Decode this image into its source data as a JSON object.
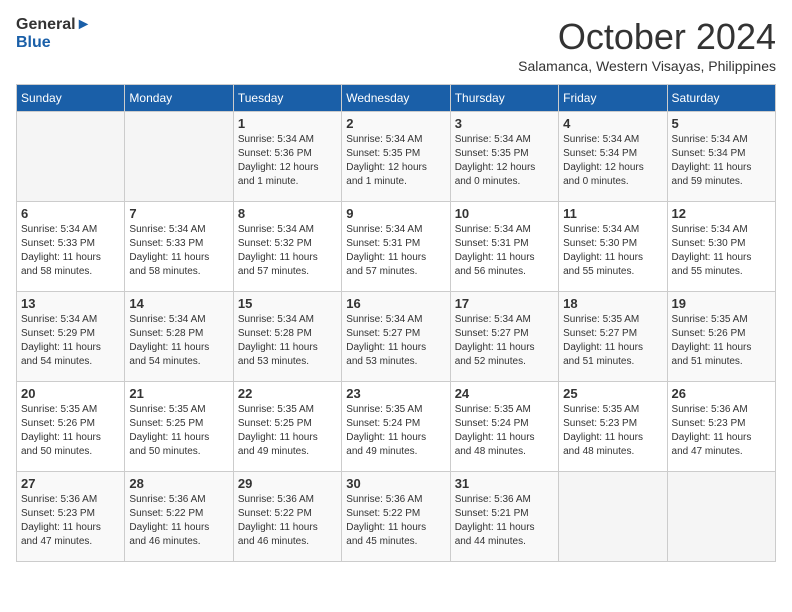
{
  "logo": {
    "line1": "General",
    "line2": "Blue"
  },
  "title": "October 2024",
  "location": "Salamanca, Western Visayas, Philippines",
  "weekdays": [
    "Sunday",
    "Monday",
    "Tuesday",
    "Wednesday",
    "Thursday",
    "Friday",
    "Saturday"
  ],
  "weeks": [
    [
      {
        "day": "",
        "info": ""
      },
      {
        "day": "",
        "info": ""
      },
      {
        "day": "1",
        "info": "Sunrise: 5:34 AM\nSunset: 5:36 PM\nDaylight: 12 hours\nand 1 minute."
      },
      {
        "day": "2",
        "info": "Sunrise: 5:34 AM\nSunset: 5:35 PM\nDaylight: 12 hours\nand 1 minute."
      },
      {
        "day": "3",
        "info": "Sunrise: 5:34 AM\nSunset: 5:35 PM\nDaylight: 12 hours\nand 0 minutes."
      },
      {
        "day": "4",
        "info": "Sunrise: 5:34 AM\nSunset: 5:34 PM\nDaylight: 12 hours\nand 0 minutes."
      },
      {
        "day": "5",
        "info": "Sunrise: 5:34 AM\nSunset: 5:34 PM\nDaylight: 11 hours\nand 59 minutes."
      }
    ],
    [
      {
        "day": "6",
        "info": "Sunrise: 5:34 AM\nSunset: 5:33 PM\nDaylight: 11 hours\nand 58 minutes."
      },
      {
        "day": "7",
        "info": "Sunrise: 5:34 AM\nSunset: 5:33 PM\nDaylight: 11 hours\nand 58 minutes."
      },
      {
        "day": "8",
        "info": "Sunrise: 5:34 AM\nSunset: 5:32 PM\nDaylight: 11 hours\nand 57 minutes."
      },
      {
        "day": "9",
        "info": "Sunrise: 5:34 AM\nSunset: 5:31 PM\nDaylight: 11 hours\nand 57 minutes."
      },
      {
        "day": "10",
        "info": "Sunrise: 5:34 AM\nSunset: 5:31 PM\nDaylight: 11 hours\nand 56 minutes."
      },
      {
        "day": "11",
        "info": "Sunrise: 5:34 AM\nSunset: 5:30 PM\nDaylight: 11 hours\nand 55 minutes."
      },
      {
        "day": "12",
        "info": "Sunrise: 5:34 AM\nSunset: 5:30 PM\nDaylight: 11 hours\nand 55 minutes."
      }
    ],
    [
      {
        "day": "13",
        "info": "Sunrise: 5:34 AM\nSunset: 5:29 PM\nDaylight: 11 hours\nand 54 minutes."
      },
      {
        "day": "14",
        "info": "Sunrise: 5:34 AM\nSunset: 5:28 PM\nDaylight: 11 hours\nand 54 minutes."
      },
      {
        "day": "15",
        "info": "Sunrise: 5:34 AM\nSunset: 5:28 PM\nDaylight: 11 hours\nand 53 minutes."
      },
      {
        "day": "16",
        "info": "Sunrise: 5:34 AM\nSunset: 5:27 PM\nDaylight: 11 hours\nand 53 minutes."
      },
      {
        "day": "17",
        "info": "Sunrise: 5:34 AM\nSunset: 5:27 PM\nDaylight: 11 hours\nand 52 minutes."
      },
      {
        "day": "18",
        "info": "Sunrise: 5:35 AM\nSunset: 5:27 PM\nDaylight: 11 hours\nand 51 minutes."
      },
      {
        "day": "19",
        "info": "Sunrise: 5:35 AM\nSunset: 5:26 PM\nDaylight: 11 hours\nand 51 minutes."
      }
    ],
    [
      {
        "day": "20",
        "info": "Sunrise: 5:35 AM\nSunset: 5:26 PM\nDaylight: 11 hours\nand 50 minutes."
      },
      {
        "day": "21",
        "info": "Sunrise: 5:35 AM\nSunset: 5:25 PM\nDaylight: 11 hours\nand 50 minutes."
      },
      {
        "day": "22",
        "info": "Sunrise: 5:35 AM\nSunset: 5:25 PM\nDaylight: 11 hours\nand 49 minutes."
      },
      {
        "day": "23",
        "info": "Sunrise: 5:35 AM\nSunset: 5:24 PM\nDaylight: 11 hours\nand 49 minutes."
      },
      {
        "day": "24",
        "info": "Sunrise: 5:35 AM\nSunset: 5:24 PM\nDaylight: 11 hours\nand 48 minutes."
      },
      {
        "day": "25",
        "info": "Sunrise: 5:35 AM\nSunset: 5:23 PM\nDaylight: 11 hours\nand 48 minutes."
      },
      {
        "day": "26",
        "info": "Sunrise: 5:36 AM\nSunset: 5:23 PM\nDaylight: 11 hours\nand 47 minutes."
      }
    ],
    [
      {
        "day": "27",
        "info": "Sunrise: 5:36 AM\nSunset: 5:23 PM\nDaylight: 11 hours\nand 47 minutes."
      },
      {
        "day": "28",
        "info": "Sunrise: 5:36 AM\nSunset: 5:22 PM\nDaylight: 11 hours\nand 46 minutes."
      },
      {
        "day": "29",
        "info": "Sunrise: 5:36 AM\nSunset: 5:22 PM\nDaylight: 11 hours\nand 46 minutes."
      },
      {
        "day": "30",
        "info": "Sunrise: 5:36 AM\nSunset: 5:22 PM\nDaylight: 11 hours\nand 45 minutes."
      },
      {
        "day": "31",
        "info": "Sunrise: 5:36 AM\nSunset: 5:21 PM\nDaylight: 11 hours\nand 44 minutes."
      },
      {
        "day": "",
        "info": ""
      },
      {
        "day": "",
        "info": ""
      }
    ]
  ]
}
